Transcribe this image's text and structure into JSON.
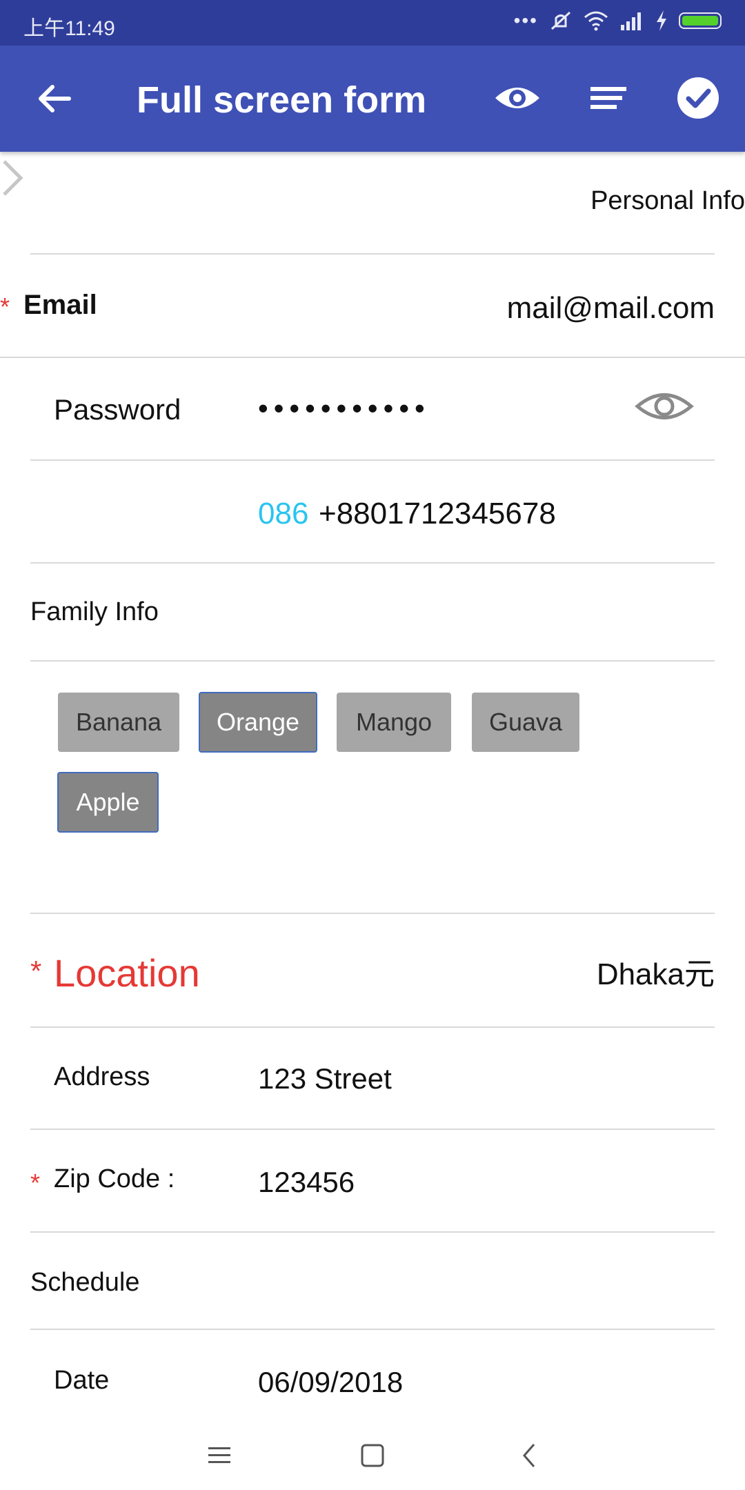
{
  "status_bar": {
    "time": "上午11:49",
    "icons": [
      "more-icon",
      "mute-icon",
      "wifi-icon",
      "signal-icon",
      "charging-icon",
      "battery-icon"
    ],
    "battery_color": "#54d12b"
  },
  "app_bar": {
    "title": "Full screen form",
    "background": "#3f51b5",
    "actions": [
      "preview-eye-icon",
      "sort-lines-icon",
      "check-circle-icon"
    ]
  },
  "form": {
    "personal_section": "Personal Info",
    "email": {
      "required_mark": "*",
      "label": "Email",
      "value": "mail@mail.com"
    },
    "password": {
      "label": "Password",
      "value": "•••••••••••"
    },
    "phone": {
      "code": "086",
      "number": "+8801712345678",
      "code_color": "#29c4f0"
    },
    "family_section": "Family Info",
    "fruits": [
      {
        "label": "Banana",
        "selected": false
      },
      {
        "label": "Orange",
        "selected": true
      },
      {
        "label": "Mango",
        "selected": false
      },
      {
        "label": "Guava",
        "selected": false
      },
      {
        "label": "Apple",
        "selected": true
      }
    ],
    "location": {
      "required_mark": "*",
      "label": "Location",
      "value": "Dhaka元"
    },
    "address": {
      "label": "Address",
      "value": "123 Street"
    },
    "zip": {
      "required_mark": "*",
      "label": "Zip Code :",
      "value": "123456"
    },
    "schedule_section": "Schedule",
    "date": {
      "label": "Date",
      "value": "06/09/2018"
    }
  },
  "nav_bar": {
    "icons": [
      "menu-icon",
      "home-square-icon",
      "back-chevron-icon"
    ]
  }
}
